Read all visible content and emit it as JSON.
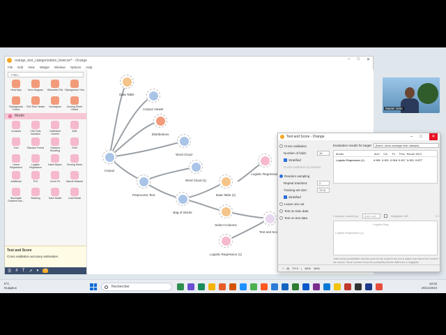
{
  "window": {
    "title": "orange_text_categorization_bowcorr* - Orange",
    "menu": [
      "File",
      "Edit",
      "View",
      "Widget",
      "Window",
      "Options",
      "Help"
    ],
    "controls": [
      "–",
      "□",
      "✕"
    ]
  },
  "left_panel": {
    "filter_placeholder": "Filter...",
    "viz_widgets": [
      {
        "label": "Heat Map",
        "color": "#f29b7a"
      },
      {
        "label": "Venn Diagram",
        "color": "#f29b7a"
      },
      {
        "label": "Silhouette Plot",
        "color": "#f29b7a"
      },
      {
        "label": "Pythagorean Tree",
        "color": "#f29b7a"
      },
      {
        "label": "Pythagorean Forest",
        "color": "#f29b7a"
      },
      {
        "label": "CN2 Rule Viewer",
        "color": "#f29b7a"
      },
      {
        "label": "Nomogram",
        "color": "#f29b7a"
      },
      {
        "label": "Scoring Sheet Viewer",
        "color": "#f29b7a"
      }
    ],
    "category": "Model",
    "model_widgets": [
      {
        "label": "Constant",
        "color": "#f5b8cc"
      },
      {
        "label": "CN2 Rule Induction",
        "color": "#f5b8cc"
      },
      {
        "label": "Calibrated Learner",
        "color": "#f5b8cc"
      },
      {
        "label": "kNN",
        "color": "#f5b8cc"
      },
      {
        "label": "Tree",
        "color": "#f5b8cc"
      },
      {
        "label": "Random Forest",
        "color": "#f5b8cc"
      },
      {
        "label": "Gradient Boosting",
        "color": "#f5b8cc"
      },
      {
        "label": "SVM",
        "color": "#f5b8cc"
      },
      {
        "label": "Linear Regression",
        "color": "#f5b8cc"
      },
      {
        "label": "Logistic Regression",
        "color": "#f5b8cc"
      },
      {
        "label": "Naive Bayes",
        "color": "#f5b8cc"
      },
      {
        "label": "Scoring Sheet",
        "color": "#f5b8cc"
      },
      {
        "label": "AdaBoost",
        "color": "#f5b8cc"
      },
      {
        "label": "PLS",
        "color": "#f5b8cc"
      },
      {
        "label": "Curve Fit",
        "color": "#f5b8cc"
      },
      {
        "label": "Neural Network",
        "color": "#f5b8cc"
      },
      {
        "label": "Stochastic Gradient Des...",
        "color": "#f5b8cc"
      },
      {
        "label": "Stacking",
        "color": "#f5b8cc"
      },
      {
        "label": "Save Model",
        "color": "#f5b8cc"
      },
      {
        "label": "Load Model",
        "color": "#f5b8cc"
      }
    ],
    "info_title": "Test and Score",
    "info_text": "Cross validation accuracy estimation."
  },
  "canvas": {
    "nodes": [
      {
        "id": "data-table",
        "label": "Data Table",
        "color": "#f5c48a"
      },
      {
        "id": "corpus-viewer",
        "label": "Corpus Viewer",
        "color": "#aac4e8"
      },
      {
        "id": "distributions",
        "label": "Distributions",
        "color": "#f29b7a"
      },
      {
        "id": "word-cloud",
        "label": "Word Cloud",
        "color": "#aac4e8"
      },
      {
        "id": "corpus",
        "label": "Corpus",
        "color": "#aac4e8"
      },
      {
        "id": "preprocess-text",
        "label": "Preprocess Text",
        "color": "#aac4e8"
      },
      {
        "id": "word-cloud-1",
        "label": "Word Cloud (1)",
        "color": "#aac4e8"
      },
      {
        "id": "bag-of-words",
        "label": "Bag of Words",
        "color": "#aac4e8"
      },
      {
        "id": "data-table-1",
        "label": "Data Table (1)",
        "color": "#f5c48a"
      },
      {
        "id": "logistic-regression",
        "label": "Logistic Regression",
        "color": "#f5b8cc"
      },
      {
        "id": "select-columns",
        "label": "Select Columns",
        "color": "#f5c48a"
      },
      {
        "id": "test-and-score",
        "label": "Test and Score",
        "color": "#e8d8f0"
      },
      {
        "id": "logistic-regression-1",
        "label": "Logistic Regression (1)",
        "color": "#f5b8cc"
      }
    ],
    "link_labels": [
      "Corpus → Data",
      "Corpus",
      "Corpus → Corpus",
      "Corpus",
      "Corpus",
      "Corpus",
      "Corpus",
      "Corpus",
      "Data",
      "Data",
      "Learner"
    ]
  },
  "dialog": {
    "title": "Test and Score - Orange",
    "controls": [
      "–",
      "□",
      "✕"
    ],
    "sampling": {
      "cross_validation": "Cross validation",
      "number_of_folds_label": "Number of folds:",
      "number_of_folds_value": "10",
      "stratified": "Stratified",
      "cv_by_feature": "Cross validation by feature",
      "random_sampling": "Random sampling",
      "repeat_label": "Repeat train/test:",
      "repeat_value": "2",
      "training_size_label": "Training set size:",
      "training_size_value": "70 %",
      "stratified2": "Stratified",
      "leave_one_out": "Leave one out",
      "test_on_train": "Test on train data",
      "test_on_test": "Test on test data"
    },
    "eval_label": "Evaluation results for target",
    "eval_target": "(None, show average over classes)",
    "results": {
      "columns": [
        "Model",
        "AUC",
        "CA",
        "F1",
        "Prec",
        "Recall",
        "MCC"
      ],
      "rows": [
        [
          "Logistic Regression (1)",
          "0.991",
          "0.921",
          "0.918",
          "0.917",
          "0.921",
          "0.877"
        ]
      ]
    },
    "compare_label": "Compare models by:",
    "compare_value": "Area und",
    "negligible_label": "Negligible diff.:",
    "negligible_value": "0.1",
    "compare_cells": [
      "Logistic Reg...",
      "Logistic Regression (1)"
    ],
    "note": "Table shows probabilities that the score for the model in the row is higher than that of the model in the column. Small numbers show the probability that the difference is negligible.",
    "status": [
      "?",
      "7974",
      "|",
      "4806",
      "4806"
    ]
  },
  "video": {
    "name": "Master SISE"
  },
  "taskbar": {
    "weather_temp": "8°C",
    "weather_desc": "Nuageux",
    "search_placeholder": "Rechercher",
    "time": "18:02",
    "date": "26/11/2024",
    "apps": [
      "#2d8f4e",
      "#6a4fd1",
      "#1a8c5b",
      "#f4b400",
      "#e65c2b",
      "#d35400",
      "#1e90ff",
      "#4caf50",
      "#ff5722",
      "#2b7bd6",
      "#1565c0",
      "#2e7d32",
      "#0a58ca",
      "#7b2d8f",
      "#0078d4",
      "#f1c40f",
      "#c0392b",
      "#333333",
      "#1e3a8a",
      "#e74c3c"
    ]
  }
}
